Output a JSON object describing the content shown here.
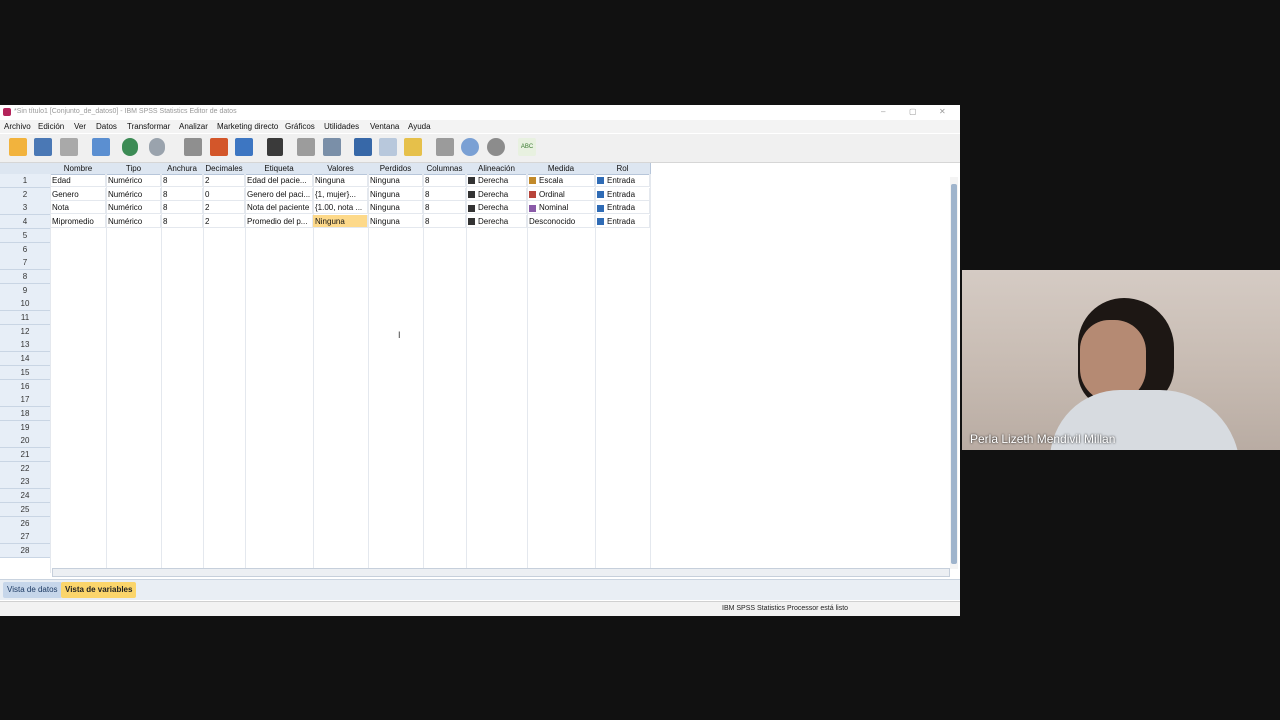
{
  "window": {
    "title": "*Sin título1 [Conjunto_de_datos0] - IBM SPSS Statistics Editor de datos",
    "minimize": "–",
    "maximize": "▢",
    "close": "✕"
  },
  "menu": [
    "Archivo",
    "Edición",
    "Ver",
    "Datos",
    "Transformar",
    "Analizar",
    "Marketing directo",
    "Gráficos",
    "Utilidades",
    "Ventana",
    "Ayuda"
  ],
  "toolbar": {
    "icons": [
      "open-icon",
      "save-icon",
      "print-icon",
      "recall-dialog-icon",
      "undo-icon",
      "redo-icon",
      "goto-case-icon",
      "goto-variable-icon",
      "variables-icon",
      "find-icon",
      "insert-cases-icon",
      "insert-variable-icon",
      "split-file-icon",
      "weight-cases-icon",
      "select-cases-icon",
      "value-labels-icon",
      "use-sets-icon",
      "show-all-variables-icon",
      "spellcheck-icon"
    ],
    "spell_label": "ABC"
  },
  "columns": [
    "Nombre",
    "Tipo",
    "Anchura",
    "Decimales",
    "Etiqueta",
    "Valores",
    "Perdidos",
    "Columnas",
    "Alineación",
    "Medida",
    "Rol"
  ],
  "rows": [
    [
      "Edad",
      "Numérico",
      "8",
      "2",
      "Edad del pacie...",
      "Ninguna",
      "Ninguna",
      "8",
      "Derecha",
      "Escala",
      "Entrada"
    ],
    [
      "Genero",
      "Numérico",
      "8",
      "0",
      "Genero del paci...",
      "{1, mujer}...",
      "Ninguna",
      "8",
      "Derecha",
      "Ordinal",
      "Entrada"
    ],
    [
      "Nota",
      "Numérico",
      "8",
      "2",
      "Nota del paciente",
      "{1.00, nota ...",
      "Ninguna",
      "8",
      "Derecha",
      "Nominal",
      "Entrada"
    ],
    [
      "Mipromedio",
      "Numérico",
      "8",
      "2",
      "Promedio del p...",
      "Ninguna",
      "Ninguna",
      "8",
      "Derecha",
      "Desconocido",
      "Entrada"
    ]
  ],
  "row_numbers": [
    "1",
    "2",
    "3",
    "4",
    "5",
    "6",
    "7",
    "8",
    "9",
    "10",
    "11",
    "12",
    "13",
    "14",
    "15",
    "16",
    "17",
    "18",
    "19",
    "20",
    "21",
    "22",
    "23",
    "24",
    "25",
    "26",
    "27",
    "28"
  ],
  "tabs": {
    "data_view": "Vista de datos",
    "variable_view": "Vista de variables"
  },
  "status": {
    "processor": "IBM SPSS Statistics Processor está listo"
  },
  "webcam": {
    "name": "Perla Lizeth Mendivil Millan"
  },
  "colors": {
    "header_bg": "#dde6f1",
    "highlight": "#fdd98a",
    "active_tab": "#fbd56b",
    "inactive_tab": "#c6d6ea"
  }
}
